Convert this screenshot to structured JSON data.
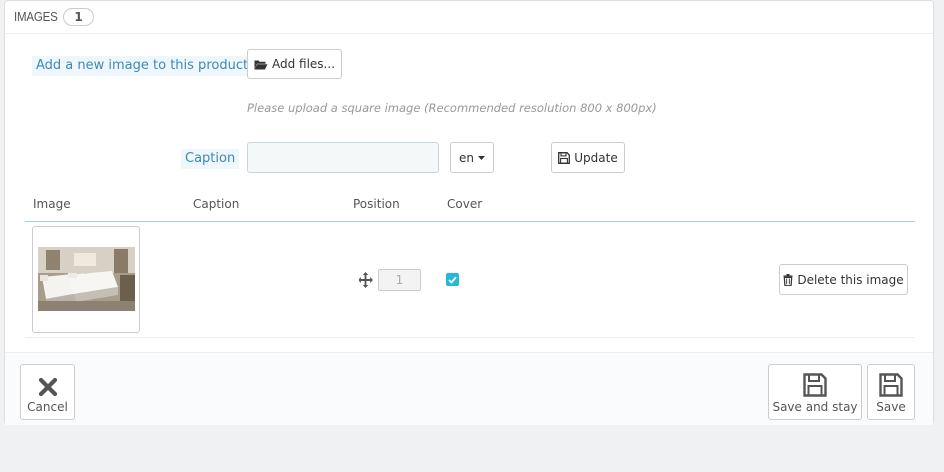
{
  "panel": {
    "title": "IMAGES",
    "count": "1"
  },
  "upload": {
    "label": "Add a new image to this product",
    "add_files_label": "Add files...",
    "hint": "Please upload a square image (Recommended resolution 800 x 800px)"
  },
  "caption": {
    "label": "Caption",
    "value": "",
    "language": "en",
    "update_label": "Update"
  },
  "table": {
    "headers": [
      "Image",
      "Caption",
      "Position",
      "Cover"
    ],
    "rows": [
      {
        "caption": "",
        "position": "1",
        "cover": true,
        "delete_label": "Delete this image"
      }
    ]
  },
  "footer": {
    "cancel_label": "Cancel",
    "save_stay_label": "Save and stay",
    "save_label": "Save"
  },
  "colors": {
    "accent": "#25b9d7",
    "label_bg": "#eef7fb",
    "label_text": "#3f88b8"
  }
}
